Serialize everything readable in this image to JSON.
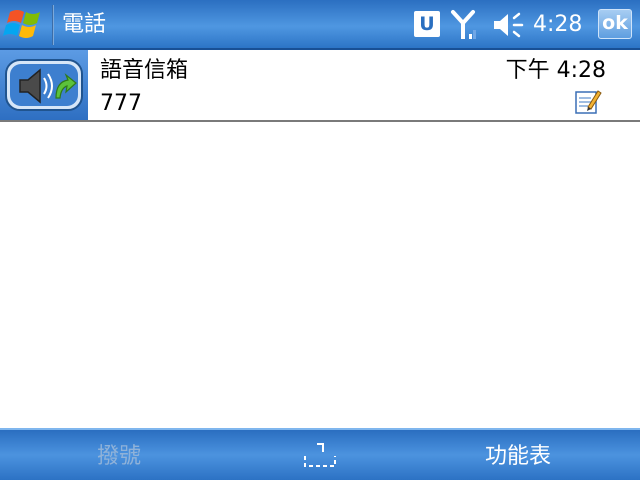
{
  "titlebar": {
    "title": "電話",
    "u_icon_label": "U",
    "clock": "4:28",
    "ok_label": "ok"
  },
  "call_log": {
    "items": [
      {
        "name": "語音信箱",
        "number": "777",
        "time": "下午 4:28",
        "icon": "voicemail-speaker-icon"
      }
    ]
  },
  "softkeys": {
    "left": "撥號",
    "right": "功能表",
    "left_enabled": false
  },
  "colors": {
    "bar_blue": "#4f97e1",
    "separator": "#7a7a7a",
    "disabled_softkey": "#8fb2d9"
  }
}
